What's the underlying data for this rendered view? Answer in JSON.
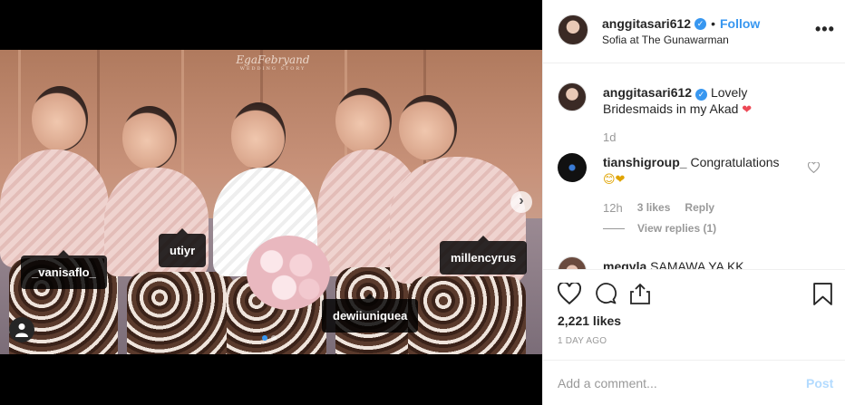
{
  "post": {
    "username": "anggitasari612",
    "follow_label": "Follow",
    "separator": "•",
    "location": "Sofia at The Gunawarman",
    "more_label": "•••"
  },
  "image": {
    "watermark_text": "EgaFebryand",
    "watermark_sub": "WEDDING STORY",
    "tags": [
      "_vanisaflo_",
      "utiyr",
      "dewiiuniquea",
      "millencyrus"
    ],
    "carousel_next": "›"
  },
  "caption": {
    "username": "anggitasari612",
    "text": "Lovely Bridesmaids in my Akad",
    "emoji": "❤",
    "time": "1d"
  },
  "comments": [
    {
      "username": "tianshigroup_",
      "text": "Congratulations",
      "emoji": "😊❤",
      "time": "12h",
      "likes": "3 likes",
      "reply_label": "Reply",
      "view_replies": "View replies (1)"
    },
    {
      "username": "megyla",
      "text": "SAMAWA YA KK"
    }
  ],
  "engagement": {
    "likes": "2,221 likes",
    "posted": "1 DAY AGO"
  },
  "comment_box": {
    "placeholder": "Add a comment...",
    "post_label": "Post"
  },
  "colors": {
    "accent": "#3897f0",
    "text": "#262626",
    "muted": "#999999",
    "post_disabled": "#b3dbff",
    "heart_red": "#ed4956"
  },
  "icons": [
    "heart-icon",
    "comment-icon",
    "share-icon",
    "bookmark-icon",
    "user-tag-icon",
    "more-icon",
    "verified-badge-icon",
    "chevron-right-icon"
  ]
}
